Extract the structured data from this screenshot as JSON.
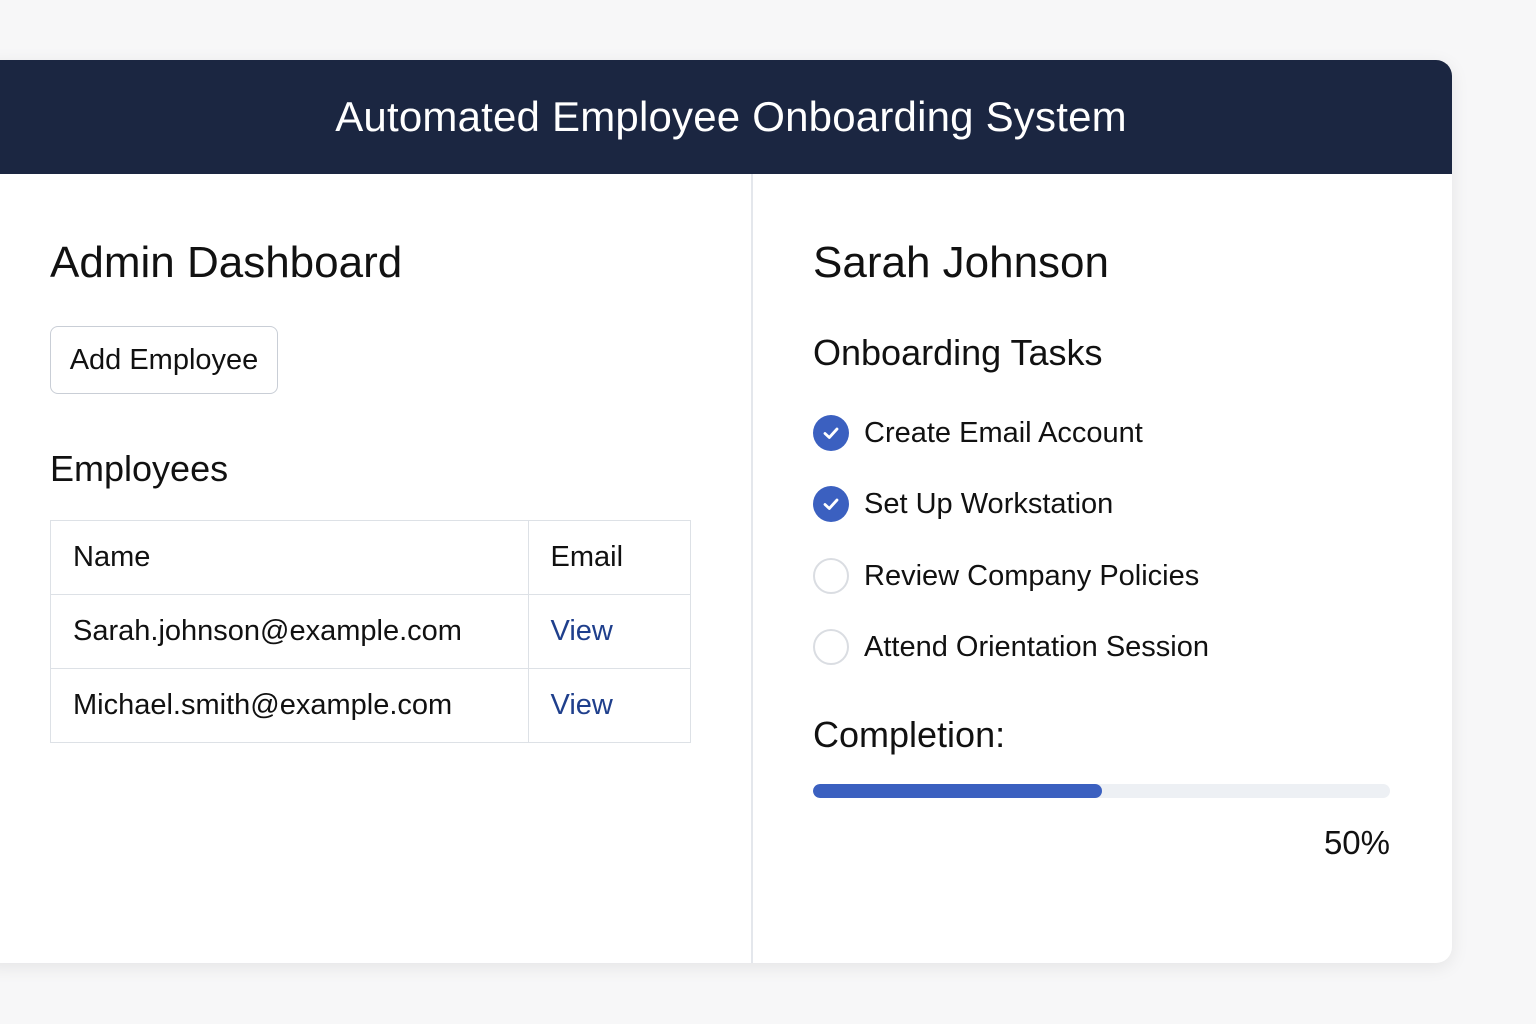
{
  "header": {
    "title": "Automated Employee Onboarding System"
  },
  "admin": {
    "title": "Admin Dashboard",
    "add_button_label": "Add Employee",
    "employees_title": "Employees",
    "table": {
      "columns": [
        "Name",
        "Email"
      ],
      "rows": [
        {
          "name": "Sarah.johnson@example.com",
          "action": "View"
        },
        {
          "name": "Michael.smith@example.com",
          "action": "View"
        }
      ]
    }
  },
  "employee": {
    "name": "Sarah Johnson",
    "tasks_title": "Onboarding Tasks",
    "tasks": [
      {
        "label": "Create Email Account",
        "done": true
      },
      {
        "label": "Set Up Workstation",
        "done": true
      },
      {
        "label": "Review Company Policies",
        "done": false
      },
      {
        "label": "Attend Orientation Session",
        "done": false
      }
    ],
    "completion_label": "Completion:",
    "completion_value": 0.5,
    "completion_text": "50%"
  },
  "colors": {
    "header_bg": "#1b2641",
    "accent": "#3b60c0",
    "link": "#1f3f8c"
  },
  "icons": {
    "checked": "check-circle-icon",
    "unchecked": "empty-circle-icon"
  }
}
